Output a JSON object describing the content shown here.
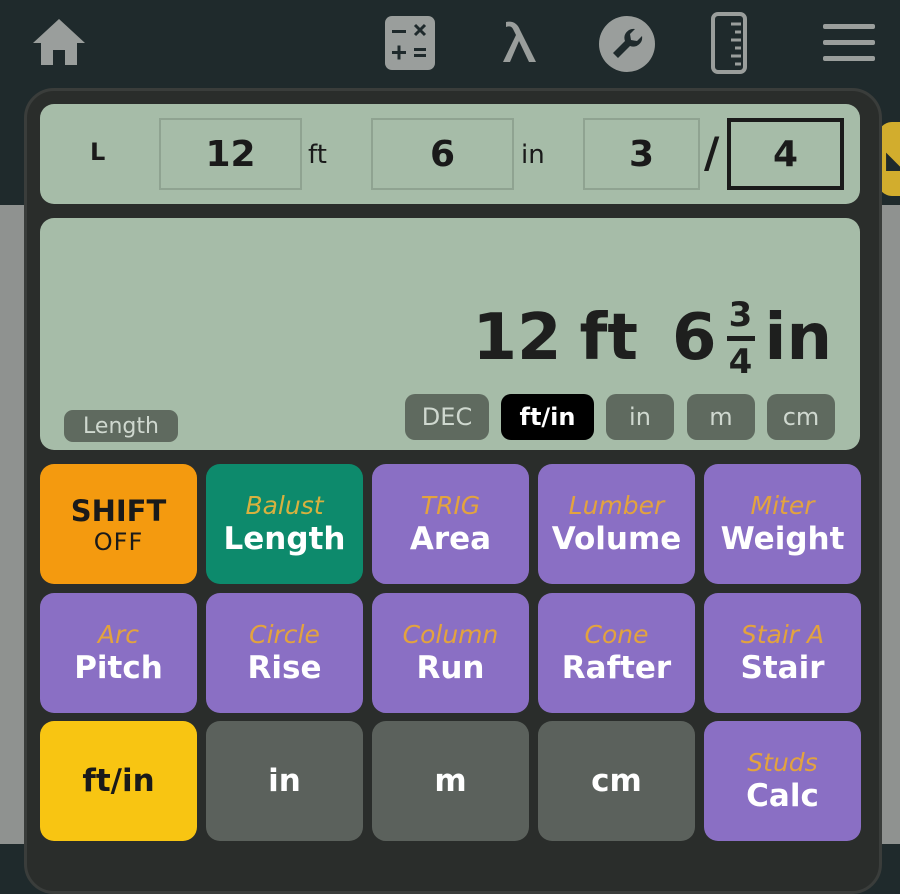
{
  "input_row": {
    "label": "L",
    "feet_value": "12",
    "feet_unit": "ft",
    "inches_value": "6",
    "inches_unit": "in",
    "numerator": "3",
    "separator": "/",
    "denominator": "4"
  },
  "display": {
    "feet": "12",
    "feet_unit": "ft",
    "inches_whole": "6",
    "frac_num": "3",
    "frac_den": "4",
    "inches_unit": "in",
    "mode_tag": "Length",
    "mode_buttons": [
      "DEC",
      "ft/in",
      "in",
      "m",
      "cm"
    ],
    "active_mode": "ft/in"
  },
  "keys": {
    "shift": {
      "label": "SHIFT",
      "state": "OFF"
    },
    "row1": [
      {
        "sub": "Balust",
        "main": "Length"
      },
      {
        "sub": "TRIG",
        "main": "Area"
      },
      {
        "sub": "Lumber",
        "main": "Volume"
      },
      {
        "sub": "Miter",
        "main": "Weight"
      }
    ],
    "row2": [
      {
        "sub": "Arc",
        "main": "Pitch"
      },
      {
        "sub": "Circle",
        "main": "Rise"
      },
      {
        "sub": "Column",
        "main": "Run"
      },
      {
        "sub": "Cone",
        "main": "Rafter"
      },
      {
        "sub": "Stair A",
        "main": "Stair"
      }
    ],
    "row3": [
      {
        "main": "ft/in"
      },
      {
        "main": "in"
      },
      {
        "main": "m"
      },
      {
        "main": "cm"
      },
      {
        "sub": "Studs",
        "main": "Calc"
      }
    ]
  },
  "icons": [
    "home-icon",
    "calculator-icon",
    "lambda-icon",
    "wrench-icon",
    "ruler-icon",
    "menu-icon"
  ],
  "colors": {
    "background": "#1f2a2c",
    "lcd": "#a6bca8",
    "shift": "#f49a0f",
    "length": "#0d8a6c",
    "purple": "#8a6fc4",
    "yellow": "#f8c512",
    "dark_key": "#5b615c",
    "secondary_text": "#e3a33e"
  }
}
